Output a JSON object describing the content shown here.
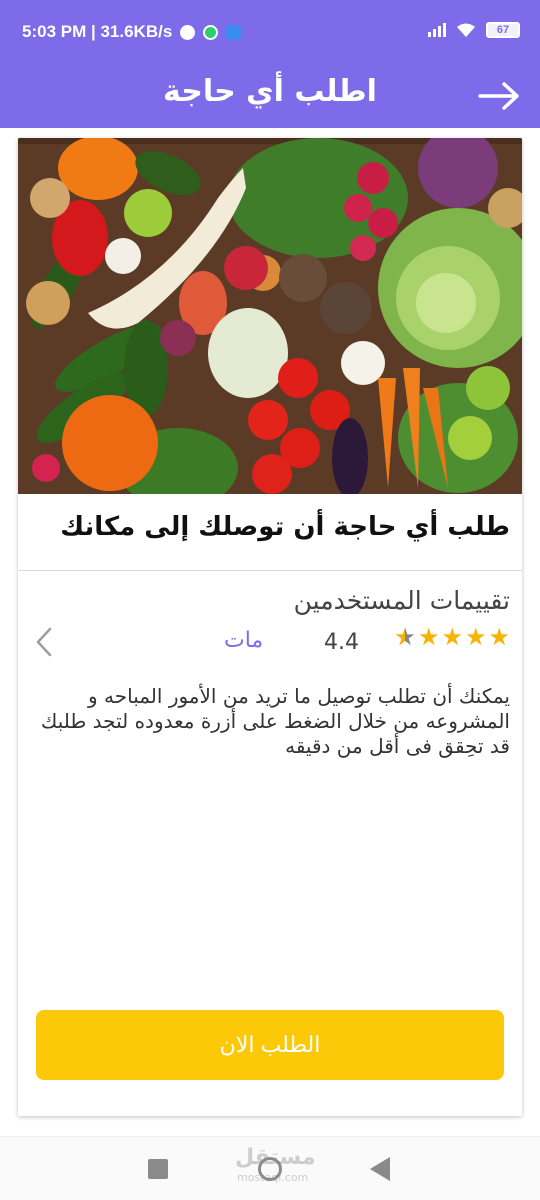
{
  "status_bar": {
    "time_info": "5:03 PM | 31.6KB/s",
    "battery": "67"
  },
  "app_bar": {
    "title": "اطلب أي حاجة"
  },
  "card": {
    "image_alt": "",
    "title": "طلب أي حاجة أن توصلك إلى مكانك",
    "ratings_heading": "تقييمات المستخدمين",
    "rating_value": "4.4",
    "rating_stars": 4.4,
    "rating_link": "مات",
    "description": "يمكنك أن تطلب توصيل ما تريد من الأمور المباحه و المشروعه من خلال الضغط على أزرة معدوده لتجد طلبك قد تحِقق فى أقل من دقيقه",
    "order_button_label": "الطلب الان"
  },
  "watermark": {
    "logo_text": "مستقل",
    "logo_sub": "mostaql.com"
  },
  "colors": {
    "primary": "#7e6bea",
    "accent": "#fcc908",
    "star": "#f4b400"
  }
}
